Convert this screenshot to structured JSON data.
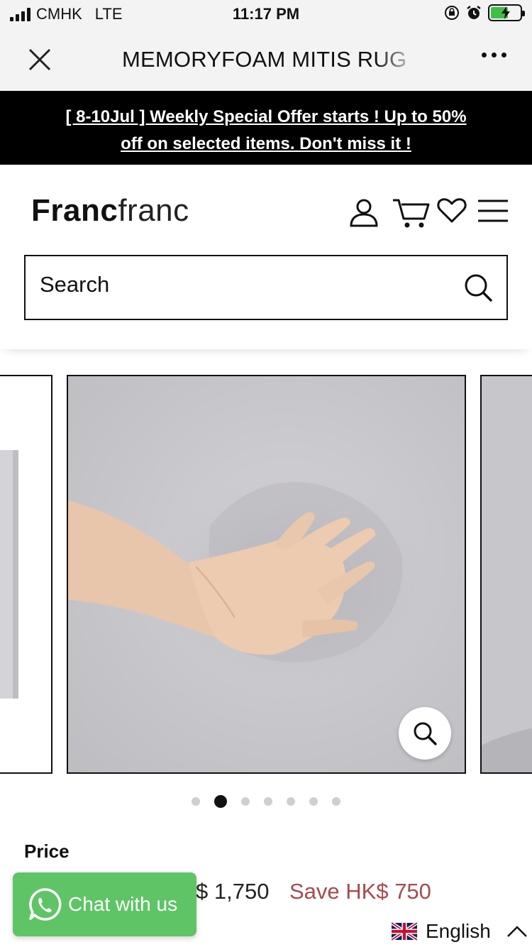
{
  "status_bar": {
    "carrier": "CMHK",
    "network": "LTE",
    "time": "11:17 PM",
    "battery_percent": 60
  },
  "browser": {
    "title": "MEMORYFOAM MITIS RUG",
    "close_icon": "close-icon",
    "more_icon": "more-icon"
  },
  "announcement": {
    "line1": "[ 8-10Jul ] Weekly Special Offer starts ! Up to 50%",
    "line2": "off on selected items. Don't miss it !"
  },
  "header": {
    "logo_bold": "Franc",
    "logo_light": "franc",
    "icons": [
      "account-icon",
      "cart-icon",
      "wishlist-heart-icon",
      "menu-icon"
    ]
  },
  "search": {
    "placeholder": "Search"
  },
  "gallery": {
    "total_slides": 7,
    "active_index": 1
  },
  "product": {
    "price_label": "Price",
    "price": "$ 1,750",
    "save": "Save HK$ 750"
  },
  "chat": {
    "label": "Chat with us"
  },
  "language": {
    "label": "English"
  },
  "colors": {
    "announcement_bg": "#000000",
    "chat_green": "#5fc466",
    "save_red": "#a84a4c",
    "battery_green": "#3fbf45"
  }
}
